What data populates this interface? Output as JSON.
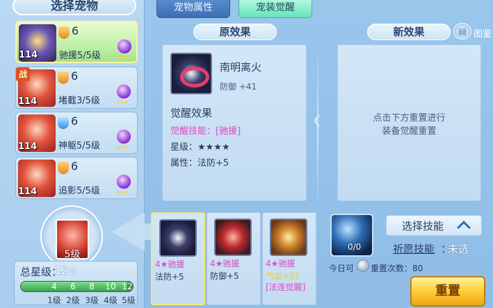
{
  "left_panel": {
    "title": "选择宠物",
    "pets": [
      {
        "level": "114",
        "num": "6",
        "skill": "驰援5/5级",
        "stars": "★★★",
        "selected": true
      },
      {
        "level": "114",
        "num": "6",
        "skill": "堵截3/5级",
        "stars": "★★★",
        "grade": "战"
      },
      {
        "level": "114",
        "num": "6",
        "skill": "神躯5/5级",
        "stars": "★★★"
      },
      {
        "level": "114",
        "num": "6",
        "skill": "追影5/5级",
        "stars": "★★★"
      }
    ],
    "total_star_label": "总星级：",
    "total_star_value": "12☆",
    "star_progress": 0.95,
    "bar_numbers": [
      "4",
      "6",
      "8",
      "10",
      "12"
    ],
    "grades": [
      "1级",
      "2级",
      "3级",
      "4级",
      "5级"
    ],
    "medallion_level": "5级"
  },
  "tabs": {
    "pet_attr": "宠物属性",
    "pet_awaken": "宠装觉醒"
  },
  "original": {
    "header": "原效果",
    "item_name": "南明离火",
    "item_stat": "防御 +41",
    "awaken_title": "觉醒效果",
    "awaken_skill": "觉醒技能：[驰援]",
    "awaken_star": "星级：★★★★",
    "awaken_attr": "属性：法防+5"
  },
  "new_effect": {
    "header": "新效果",
    "hint_line1": "点击下方重置进行",
    "hint_line2": "装备觉醒重置",
    "codex_label": "图鉴"
  },
  "equipment": [
    {
      "skill": "4★驰援",
      "stat": "法防+5"
    },
    {
      "skill": "4★驰援",
      "stat": "防御+5"
    },
    {
      "skill": "4★驰援",
      "stat": "气血+57",
      "extra": "[法连觉醒]"
    }
  ],
  "reset": {
    "count": "0/0",
    "today_label": "今日可",
    "times": "重置次数：80",
    "select_skill": "选择技能",
    "pray_label": "祈愿技能",
    "pray_colon": "：",
    "pray_value": "未选",
    "button_label": "重置"
  },
  "colors": {
    "accent": "#66e3be",
    "skill_pink": "#e047c5",
    "button_gold": "#ffd23f"
  }
}
